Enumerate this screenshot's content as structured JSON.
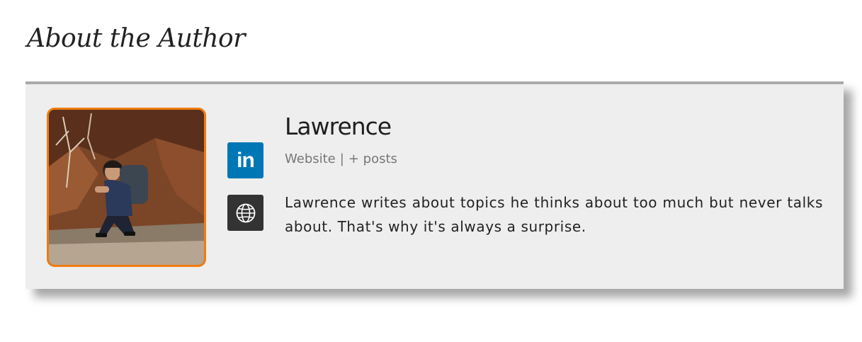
{
  "section": {
    "title": "About the Author"
  },
  "author": {
    "name": "Lawrence",
    "meta": {
      "website_label": "Website",
      "separator": "|",
      "posts_label": "+ posts"
    },
    "bio": "Lawrence writes about topics he thinks about too much but never talks about. That's why it's always a surprise.",
    "photo_icon": "author-photo"
  },
  "social": {
    "linkedin": {
      "icon": "linkedin-icon",
      "glyph": "in",
      "color": "#0077b5"
    },
    "website": {
      "icon": "globe-icon",
      "color": "#333333"
    }
  },
  "colors": {
    "box_background": "#eeeeee",
    "box_top_border": "#aaaaaa",
    "avatar_border": "#f07c10",
    "meta_text": "#777777"
  }
}
